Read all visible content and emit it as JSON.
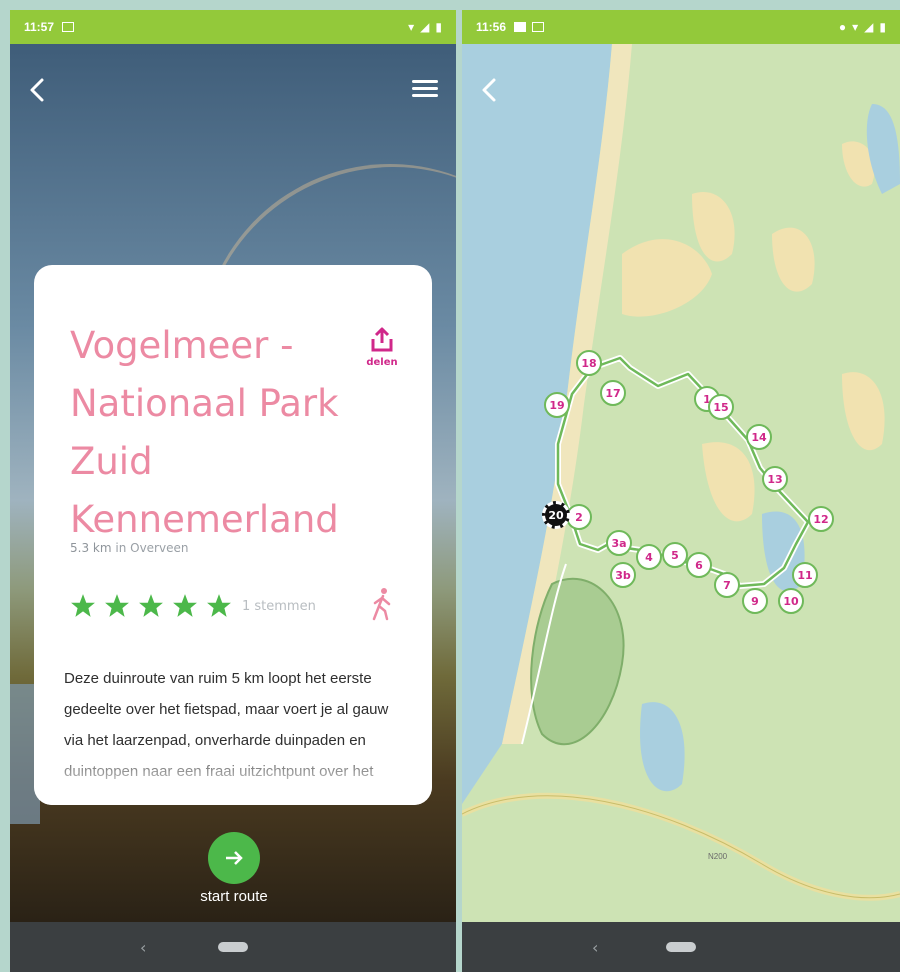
{
  "left_screen": {
    "status": {
      "time": "11:57"
    },
    "route": {
      "title": "Vogelmeer - Nationaal Park Zuid Kennemerland",
      "share_label": "delen",
      "distance": "5.3 km",
      "location": "in Overveen",
      "rating": 5,
      "votes": "1 stemmen",
      "description": "Deze duinroute van ruim 5 km loopt het eerste gedeelte over het fietspad, maar voert je al gauw via het laarzenpad, onverharde duinpaden en duintoppen naar een fraai uitzichtpunt over het"
    },
    "start_label": "start route"
  },
  "right_screen": {
    "status": {
      "time": "11:56"
    },
    "start_marker": "20",
    "markers": [
      "2",
      "3a",
      "3b",
      "4",
      "5",
      "6",
      "7",
      "9",
      "10",
      "11",
      "12",
      "13",
      "14",
      "1",
      "15",
      "17",
      "18",
      "19"
    ],
    "road_label": "N200"
  },
  "colors": {
    "status_bar": "#93c93a",
    "title_pink": "#ec8aa3",
    "accent_magenta": "#d0288a",
    "star_green": "#4cb84a",
    "route_green": "#6fb95a"
  },
  "icons": {
    "back": "chevron-left-icon",
    "menu": "hamburger-menu-icon",
    "share": "share-icon",
    "walk": "walking-person-icon",
    "start": "arrow-right-icon"
  }
}
